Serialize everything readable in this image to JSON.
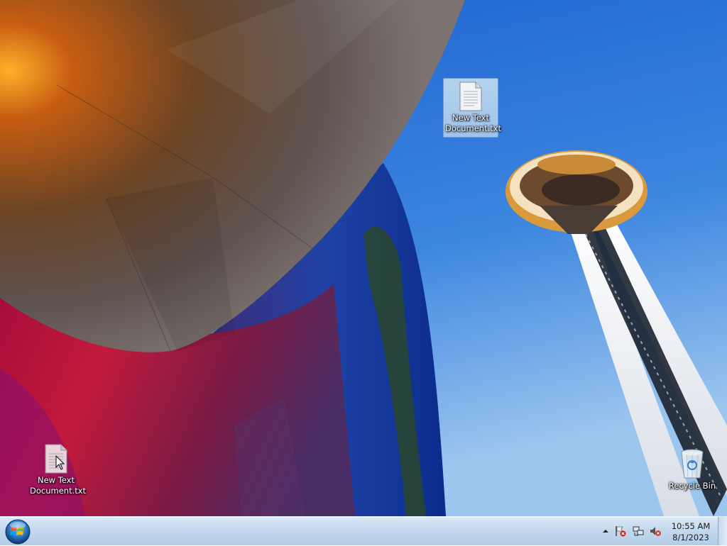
{
  "desktop": {
    "icons": [
      {
        "label": "New Text Document.txt",
        "label_lines": [
          "New Text",
          "Document.txt"
        ],
        "icon": "text-file-icon",
        "selected": true
      },
      {
        "label": "New Text Document.txt",
        "label_lines": [
          "New Text",
          "Document.txt"
        ],
        "icon": "text-file-icon",
        "selected": false
      },
      {
        "label": "Recycle Bin",
        "icon": "recycle-bin-icon",
        "selected": false
      }
    ]
  },
  "taskbar": {
    "start_icon": "windows-start-orb",
    "tray_icons": [
      "show-hidden-icons-arrow",
      "action-center-flag-icon",
      "network-icon",
      "volume-muted-icon"
    ],
    "clock": {
      "time": "10:55 AM",
      "date": "8/1/2023"
    }
  },
  "colors": {
    "sky": "#2f6fd0",
    "taskbar": "#c4d9ee",
    "selection": "#a6c8ea"
  }
}
